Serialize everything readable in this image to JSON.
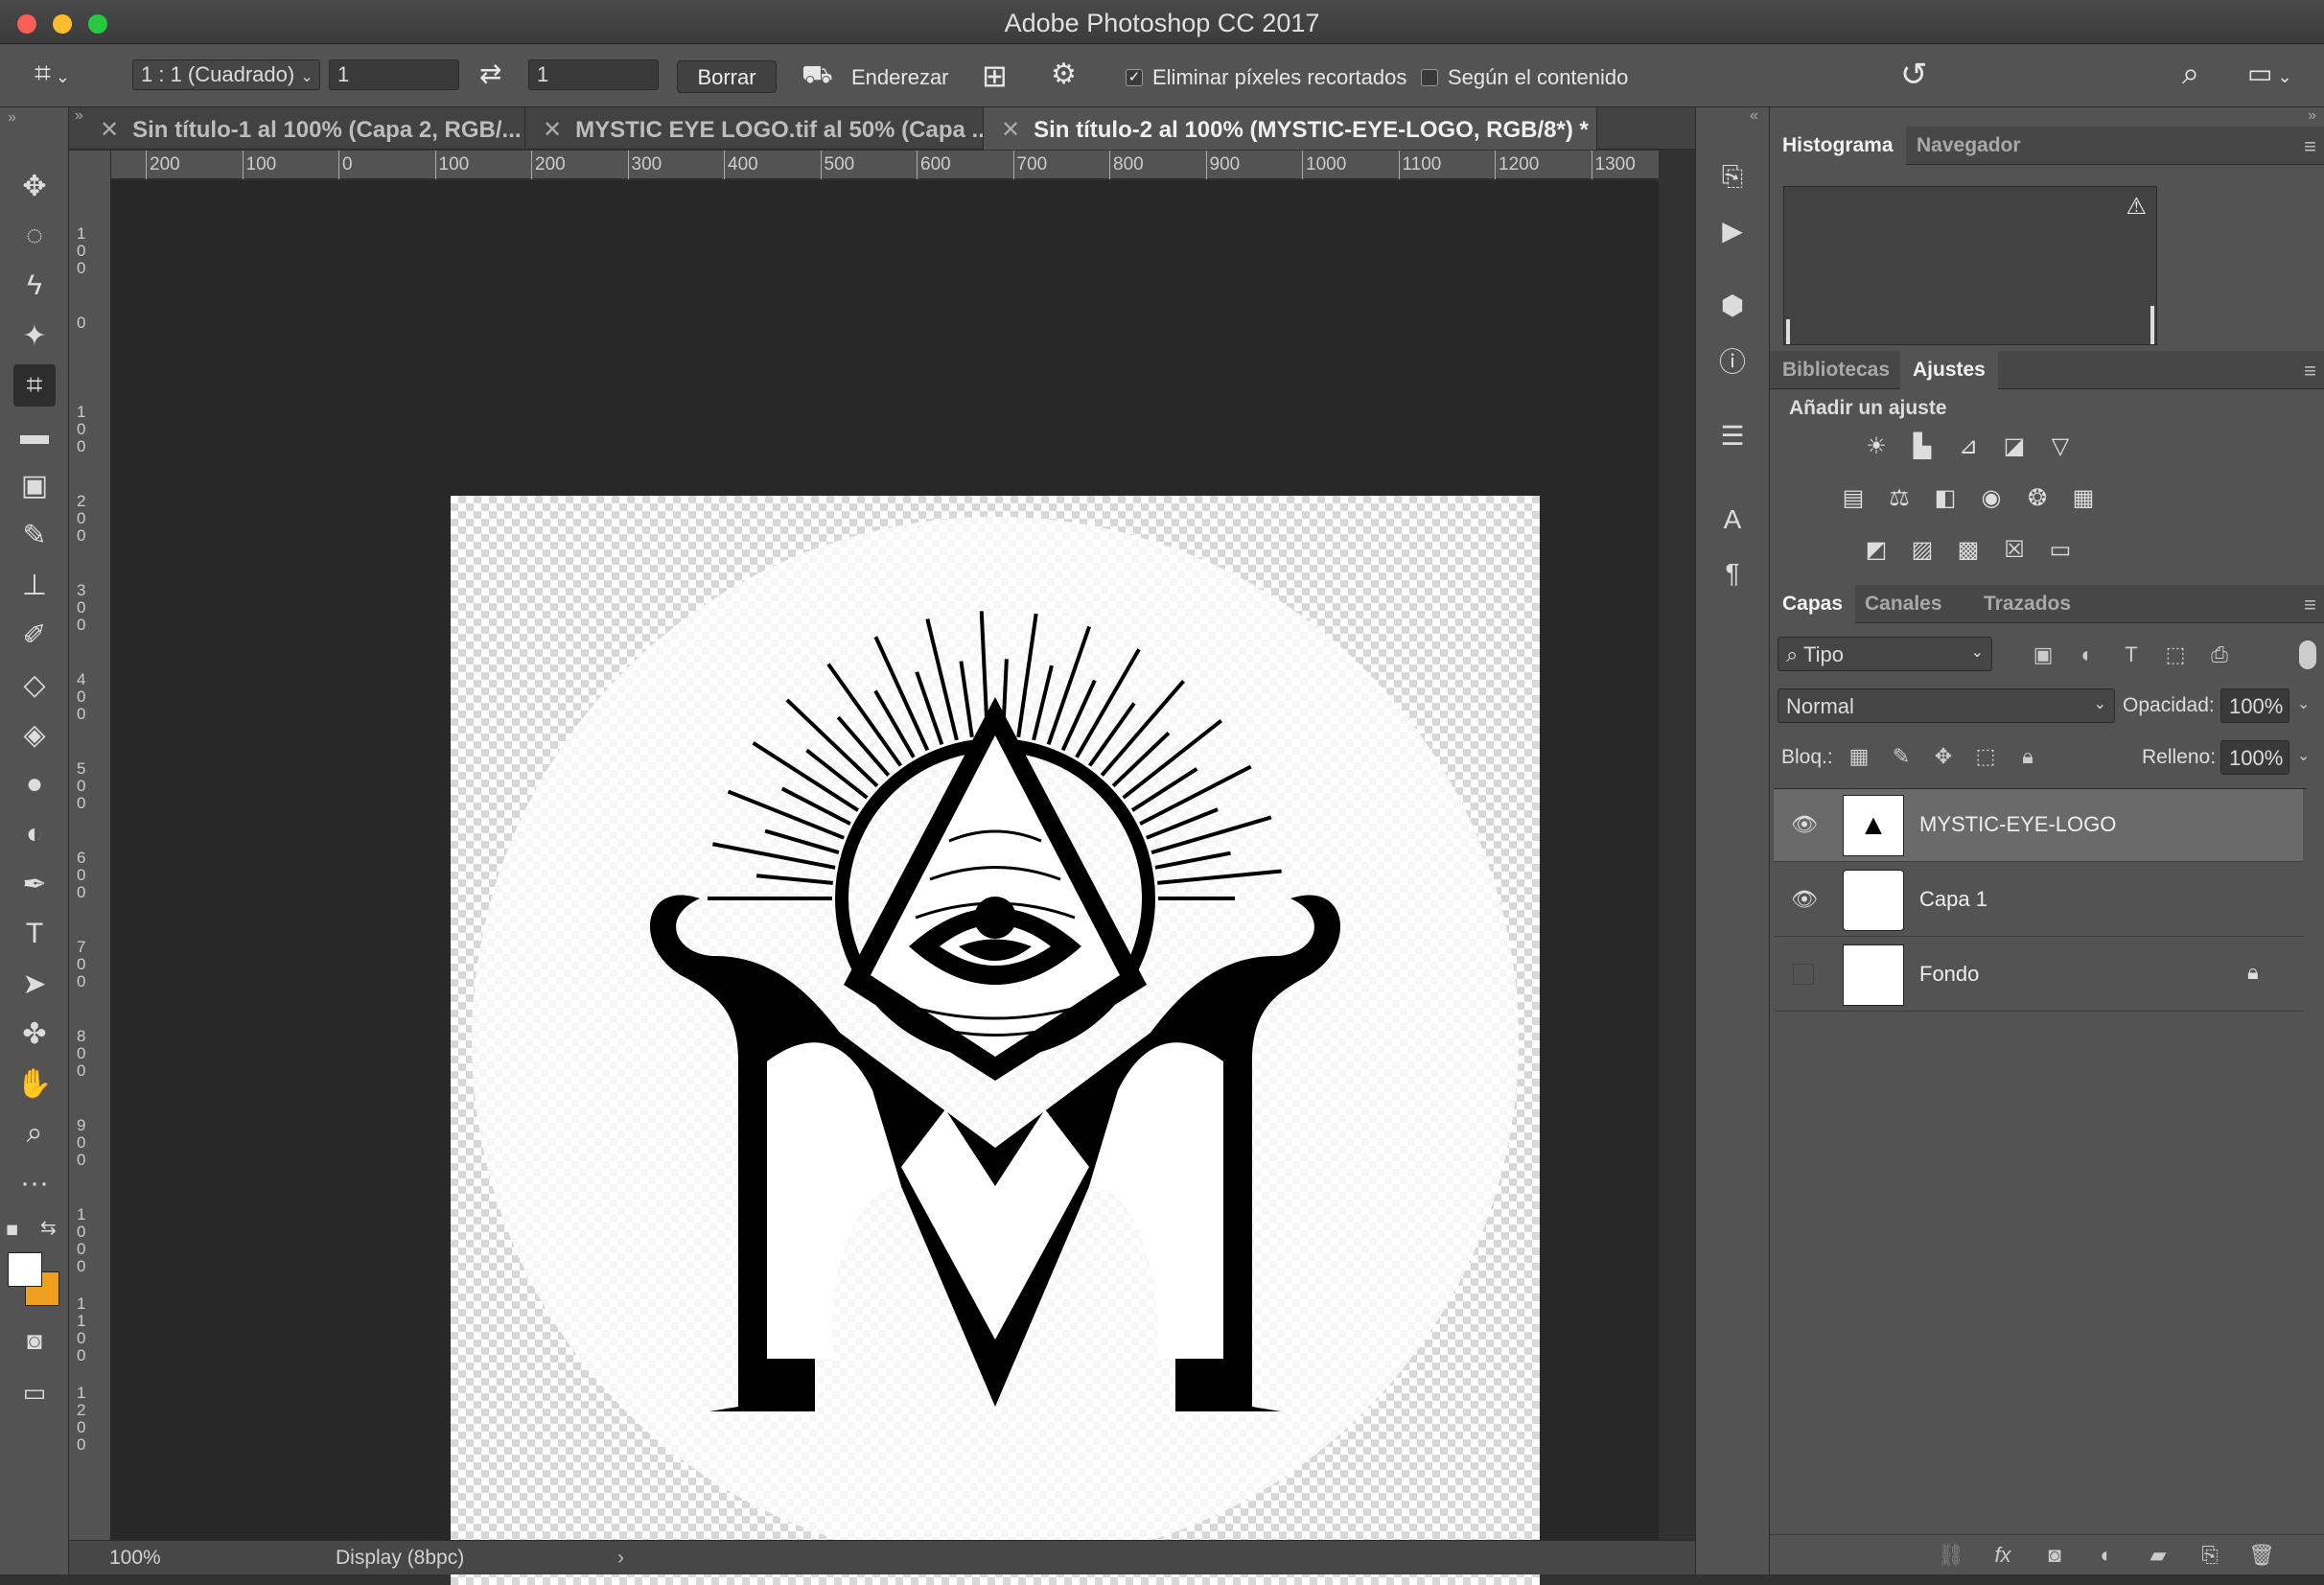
{
  "window": {
    "title": "Adobe Photoshop CC 2017"
  },
  "options_bar": {
    "ratio_preset": "1 : 1 (Cuadrado)",
    "width_value": "1",
    "height_value": "1",
    "clear_label": "Borrar",
    "straighten_label": "Enderezar",
    "delete_cropped_label": "Eliminar píxeles recortados",
    "delete_cropped_checked": true,
    "content_aware_label": "Según el contenido",
    "content_aware_checked": false
  },
  "doc_tabs": [
    {
      "label": "Sin título-1 al 100% (Capa 2, RGB/...",
      "active": false
    },
    {
      "label": "MYSTIC EYE LOGO.tif al 50% (Capa ...",
      "active": false
    },
    {
      "label": "Sin título-2 al 100% (MYSTIC-EYE-LOGO, RGB/8*) *",
      "active": true
    }
  ],
  "ruler": {
    "horizontal": [
      "200",
      "100",
      "0",
      "100",
      "200",
      "300",
      "400",
      "500",
      "600",
      "700",
      "800",
      "900",
      "1000",
      "1100",
      "1200",
      "1300"
    ],
    "vertical": [
      "100",
      "0",
      "100",
      "200",
      "300",
      "400",
      "500",
      "600",
      "700",
      "800",
      "900",
      "1000",
      "1100",
      "1200"
    ]
  },
  "status": {
    "zoom": "100%",
    "display": "Display (8bpc)"
  },
  "panels": {
    "histogram_tabs": [
      "Histograma",
      "Navegador"
    ],
    "adjust_tabs": [
      "Bibliotecas",
      "Ajustes"
    ],
    "add_adjustment_label": "Añadir un ajuste",
    "layers_tabs": [
      "Capas",
      "Canales",
      "Trazados"
    ],
    "filter_kind": "Tipo",
    "blend_mode": "Normal",
    "opacity_label": "Opacidad:",
    "opacity_value": "100%",
    "lock_label": "Bloq.:",
    "fill_label": "Relleno:",
    "fill_value": "100%",
    "layers": [
      {
        "name": "MYSTIC-EYE-LOGO",
        "visible": true,
        "selected": true,
        "locked": false
      },
      {
        "name": "Capa 1",
        "visible": true,
        "selected": false,
        "locked": false
      },
      {
        "name": "Fondo",
        "visible": false,
        "selected": false,
        "locked": true
      }
    ]
  },
  "colors": {
    "foreground": "#ffffff",
    "background": "#f0a020",
    "accent": "#535353"
  }
}
